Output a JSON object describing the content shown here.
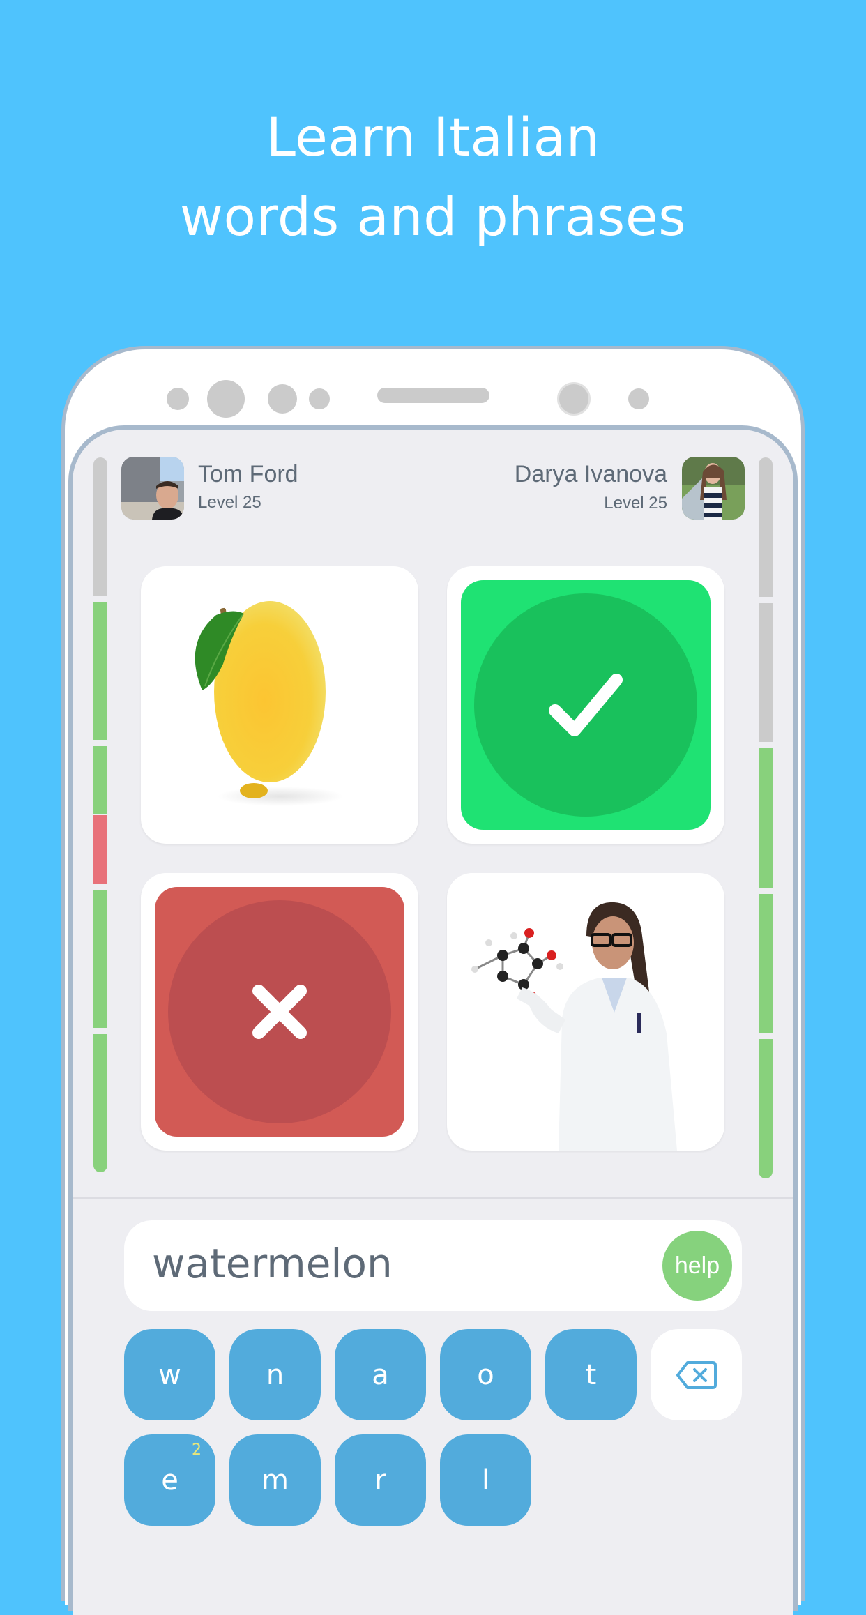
{
  "headline": {
    "line1": "Learn Italian",
    "line2": "words and phrases"
  },
  "colors": {
    "background": "#4fc3fd",
    "correct": "#1fe273",
    "correct_inner": "#19c15c",
    "wrong": "#d25a55",
    "wrong_inner": "#bc4e50",
    "progress_correct": "#88d17c",
    "progress_wrong": "#e8717a",
    "progress_pending": "#cbcbcb",
    "key": "#52abdc",
    "help": "#86d27d"
  },
  "players": {
    "left": {
      "name": "Tom Ford",
      "level": "Level 25",
      "avatar": "tom-ford-avatar"
    },
    "right": {
      "name": "Darya Ivanova",
      "level": "Level 25",
      "avatar": "darya-ivanova-avatar"
    }
  },
  "progress": {
    "left": [
      "pending",
      "correct",
      "correct",
      "wrong",
      "correct",
      "correct"
    ],
    "right": [
      "pending",
      "pending",
      "correct",
      "correct",
      "correct"
    ]
  },
  "cards": [
    {
      "type": "image",
      "subject": "lemon"
    },
    {
      "type": "result",
      "state": "correct",
      "icon": "checkmark-icon"
    },
    {
      "type": "result",
      "state": "wrong",
      "icon": "cross-icon"
    },
    {
      "type": "image",
      "subject": "scientist"
    }
  ],
  "answer": {
    "value": "watermelon",
    "help_label": "help"
  },
  "keyboard": {
    "row1": [
      {
        "letter": "w",
        "count": ""
      },
      {
        "letter": "n",
        "count": ""
      },
      {
        "letter": "a",
        "count": ""
      },
      {
        "letter": "o",
        "count": ""
      },
      {
        "letter": "t",
        "count": ""
      }
    ],
    "backspace_icon": "backspace-icon",
    "row2": [
      {
        "letter": "e",
        "count": "2"
      },
      {
        "letter": "m",
        "count": ""
      },
      {
        "letter": "r",
        "count": ""
      },
      {
        "letter": "l",
        "count": ""
      }
    ]
  }
}
